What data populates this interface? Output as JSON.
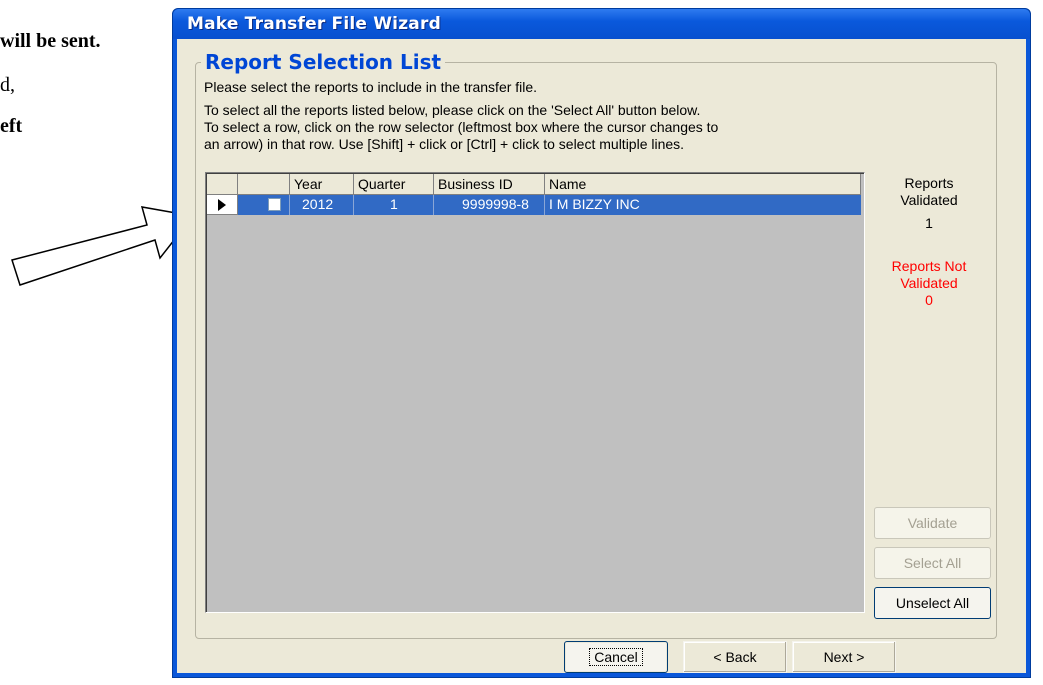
{
  "doc": {
    "line1": "will be sent.",
    "line2": "d,",
    "line3": "eft"
  },
  "window": {
    "title": "Make Transfer File Wizard",
    "group_title": "Report Selection List",
    "instructions": [
      "Please select the reports to include in the transfer file.",
      "To select all the reports listed below, please click on the 'Select All' button below.",
      "To select a row, click on the row selector (leftmost box where the cursor changes to",
      "an arrow) in that row.  Use [Shift] + click or [Ctrl] + click to select multiple lines."
    ],
    "table": {
      "columns": [
        "",
        "",
        "Year",
        "Quarter",
        "Business ID",
        "Name"
      ],
      "rows": [
        {
          "checked": false,
          "year": "2012",
          "quarter": "1",
          "business_id": "9999998-8",
          "name": "I M BIZZY INC"
        }
      ]
    },
    "status": {
      "validated_label_1": "Reports",
      "validated_label_2": "Validated",
      "validated_count": "1",
      "not_validated_label_1": "Reports Not",
      "not_validated_label_2": "Validated",
      "not_validated_count": "0",
      "not_validated_color": "#ff0000"
    },
    "buttons": {
      "validate": "Validate",
      "select_all": "Select All",
      "unselect_all": "Unselect All",
      "cancel": "Cancel",
      "back": "< Back",
      "next": "Next >"
    }
  },
  "colors": {
    "title_bar": "#0a59dc",
    "selection": "#316ac5",
    "group_title": "#0046d5"
  },
  "icons": [
    "row-pointer-icon",
    "callout-arrow-icon"
  ]
}
